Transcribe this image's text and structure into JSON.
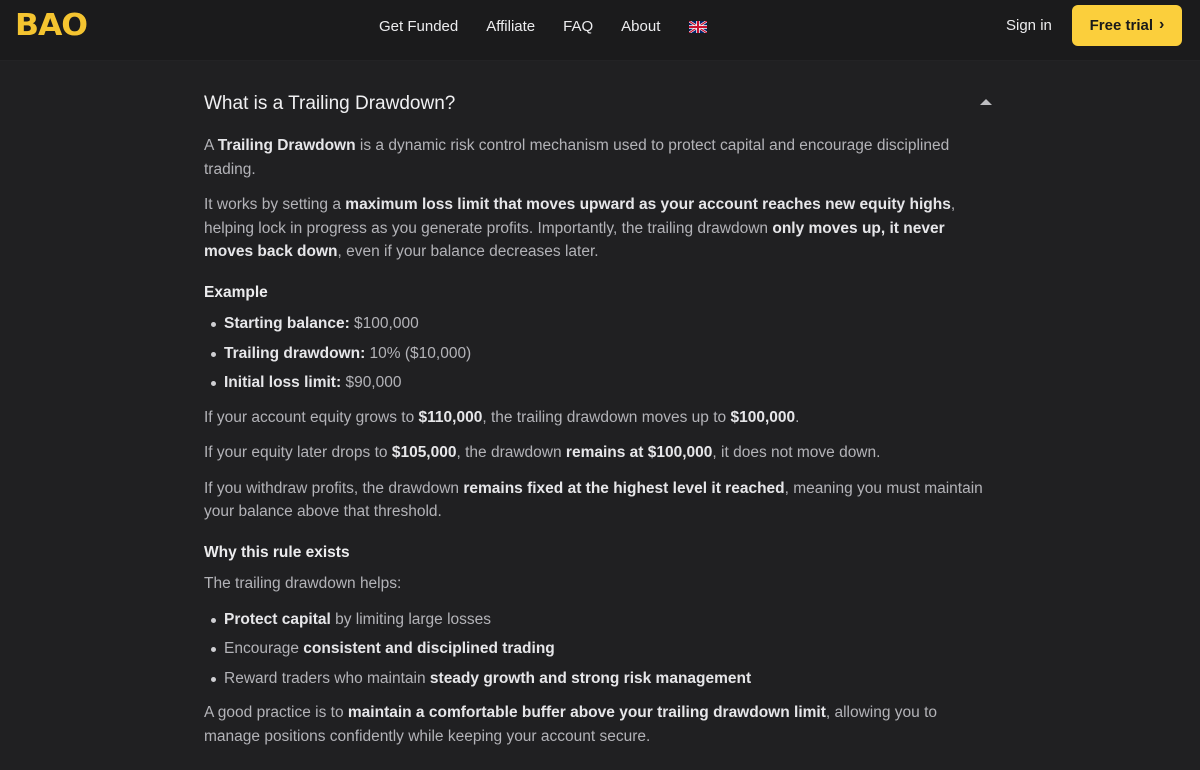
{
  "header": {
    "logo_text": "BAO",
    "nav": [
      "Get Funded",
      "Affiliate",
      "FAQ",
      "About"
    ],
    "signin": "Sign in",
    "cta": "Free trial",
    "cta_icon": "chevron-right-icon",
    "brand_color": "#f4c430"
  },
  "faq": {
    "title": "What is a Trailing Drawdown?",
    "toggle_icon": "caret-up-icon",
    "p1": {
      "a": "A ",
      "b": "Trailing Drawdown",
      "c": " is a dynamic risk control mechanism used to protect capital and encourage disciplined trading."
    },
    "p2": {
      "a": "It works by setting a ",
      "b": "maximum loss limit that moves upward as your account reaches new equity highs",
      "c": ", helping lock in progress as you generate profits. Importantly, the trailing drawdown ",
      "d": "only moves up, it never moves back down",
      "e": ", even if your balance decreases later."
    },
    "example_heading": "Example",
    "example_items": [
      {
        "label": "Starting balance:",
        "value": " $100,000"
      },
      {
        "label": "Trailing drawdown:",
        "value": " 10% ($10,000)"
      },
      {
        "label": "Initial loss limit:",
        "value": " $90,000"
      }
    ],
    "p3": {
      "a": "If your account equity grows to ",
      "b": "$110,000",
      "c": ", the trailing drawdown moves up to ",
      "d": "$100,000",
      "e": "."
    },
    "p4": {
      "a": "If your equity later drops to ",
      "b": "$105,000",
      "c": ", the drawdown ",
      "d": "remains at $100,000",
      "e": ", it does not move down."
    },
    "p5": {
      "a": "If you withdraw profits, the drawdown ",
      "b": "remains fixed at the highest level it reached",
      "c": ", meaning you must maintain your balance above that threshold."
    },
    "why_heading": "Why this rule exists",
    "p6": "The trailing drawdown helps:",
    "why_items": [
      {
        "pre": "",
        "bold": "Protect capital",
        "post": " by limiting large losses"
      },
      {
        "pre": "Encourage ",
        "bold": "consistent and disciplined trading",
        "post": ""
      },
      {
        "pre": "Reward traders who maintain ",
        "bold": "steady growth and strong risk management",
        "post": ""
      }
    ],
    "p7": {
      "a": "A good practice is to ",
      "b": "maintain a comfortable buffer above your trailing drawdown limit",
      "c": ", allowing you to manage positions confidently while keeping your account secure."
    }
  }
}
